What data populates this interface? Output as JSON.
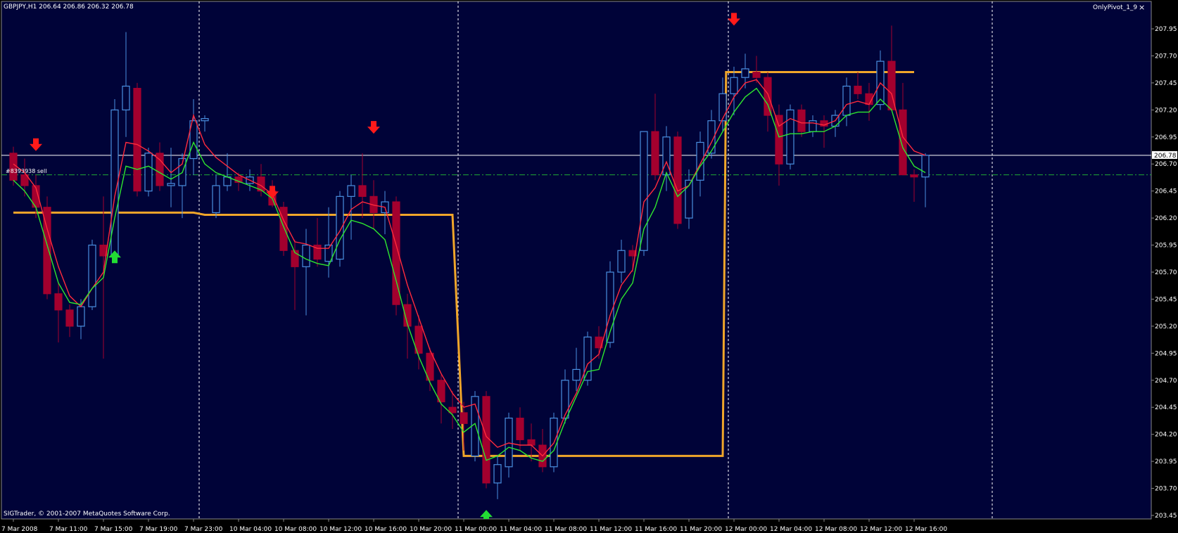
{
  "window": {
    "symbol_header": "GBPJPY,H1  206.64 206.86 206.32 206.78",
    "indicator_name": "OnlyPivot_1_9",
    "close_glyph": "×",
    "copyright": "SIGTrader, © 2001-2007 MetaQuotes Software Corp.",
    "order_label": "#8393938 sell",
    "current_price_label": "206.78"
  },
  "colors": {
    "background": "#000338",
    "bull_candle": "#4a8fe0",
    "bear_candle": "#a3002e",
    "fast_ma": "#ff2a3c",
    "slow_ma": "#2ee62e",
    "pivot": "#f0a62a",
    "order_line": "#1faa33",
    "current_price_line": "#ffffff",
    "separator": "#ffffff",
    "up_arrow": "#22dd33",
    "down_arrow": "#ff1a1a",
    "axis_text": "#ffffff"
  },
  "chart_data": {
    "type": "candlestick",
    "symbol": "GBPJPY",
    "timeframe": "H1",
    "ylim": [
      203.4,
      208.2
    ],
    "y_ticks": [
      207.95,
      207.7,
      207.45,
      207.2,
      206.95,
      206.7,
      206.45,
      206.2,
      205.95,
      205.7,
      205.45,
      205.2,
      204.95,
      204.7,
      204.45,
      204.2,
      203.95,
      203.7,
      203.45
    ],
    "y_tick_labels": [
      "207.95",
      "207.70",
      "207.45",
      "207.20",
      "206.95",
      "206.70",
      "206.45",
      "206.20",
      "205.95",
      "205.70",
      "205.45",
      "205.20",
      "204.95",
      "204.70",
      "204.45",
      "204.20",
      "203.95",
      "203.70",
      "203.45"
    ],
    "x_labels": [
      "7 Mar 2008",
      "7 Mar 11:00",
      "7 Mar 15:00",
      "7 Mar 19:00",
      "7 Mar 23:00",
      "10 Mar 04:00",
      "10 Mar 08:00",
      "10 Mar 12:00",
      "10 Mar 16:00",
      "10 Mar 20:00",
      "11 Mar 00:00",
      "11 Mar 04:00",
      "11 Mar 08:00",
      "11 Mar 12:00",
      "11 Mar 16:00",
      "11 Mar 20:00",
      "12 Mar 00:00",
      "12 Mar 04:00",
      "12 Mar 08:00",
      "12 Mar 12:00",
      "12 Mar 16:00"
    ],
    "x_label_bars": [
      0,
      4,
      8,
      12,
      16,
      20,
      24,
      28,
      32,
      36,
      40,
      44,
      48,
      52,
      56,
      60,
      64,
      68,
      72,
      76,
      80
    ],
    "session_separators_at_bar": [
      17,
      40,
      64
    ],
    "current_price": 206.78,
    "order_line_price": 206.6,
    "candles": [
      {
        "o": 206.8,
        "h": 206.86,
        "l": 206.5,
        "c": 206.55
      },
      {
        "o": 206.6,
        "h": 206.75,
        "l": 206.4,
        "c": 206.5
      },
      {
        "o": 206.5,
        "h": 206.6,
        "l": 206.2,
        "c": 206.3
      },
      {
        "o": 206.3,
        "h": 206.4,
        "l": 205.45,
        "c": 205.5
      },
      {
        "o": 205.5,
        "h": 205.6,
        "l": 205.05,
        "c": 205.35
      },
      {
        "o": 205.35,
        "h": 205.4,
        "l": 205.1,
        "c": 205.2
      },
      {
        "o": 205.2,
        "h": 205.45,
        "l": 205.08,
        "c": 205.38
      },
      {
        "o": 205.38,
        "h": 206.0,
        "l": 205.35,
        "c": 205.95
      },
      {
        "o": 205.95,
        "h": 206.4,
        "l": 204.9,
        "c": 205.85
      },
      {
        "o": 205.85,
        "h": 207.3,
        "l": 205.8,
        "c": 207.2
      },
      {
        "o": 207.2,
        "h": 207.92,
        "l": 206.95,
        "c": 207.42
      },
      {
        "o": 207.4,
        "h": 207.45,
        "l": 206.4,
        "c": 206.45
      },
      {
        "o": 206.45,
        "h": 206.85,
        "l": 206.4,
        "c": 206.8
      },
      {
        "o": 206.8,
        "h": 206.9,
        "l": 206.45,
        "c": 206.5
      },
      {
        "o": 206.5,
        "h": 206.85,
        "l": 206.3,
        "c": 206.52
      },
      {
        "o": 206.5,
        "h": 206.8,
        "l": 206.2,
        "c": 206.75
      },
      {
        "o": 206.75,
        "h": 207.3,
        "l": 206.6,
        "c": 207.1
      },
      {
        "o": 207.1,
        "h": 207.15,
        "l": 207.0,
        "c": 207.12
      },
      {
        "o": 206.25,
        "h": 206.6,
        "l": 206.2,
        "c": 206.5
      },
      {
        "o": 206.5,
        "h": 206.8,
        "l": 206.45,
        "c": 206.58
      },
      {
        "o": 206.58,
        "h": 206.62,
        "l": 206.45,
        "c": 206.53
      },
      {
        "o": 206.52,
        "h": 206.65,
        "l": 206.45,
        "c": 206.58
      },
      {
        "o": 206.58,
        "h": 206.7,
        "l": 206.4,
        "c": 206.45
      },
      {
        "o": 206.45,
        "h": 206.55,
        "l": 206.3,
        "c": 206.32
      },
      {
        "o": 206.3,
        "h": 206.35,
        "l": 205.85,
        "c": 205.9
      },
      {
        "o": 205.9,
        "h": 206.0,
        "l": 205.35,
        "c": 205.75
      },
      {
        "o": 205.75,
        "h": 206.1,
        "l": 205.3,
        "c": 205.95
      },
      {
        "o": 205.95,
        "h": 206.2,
        "l": 205.75,
        "c": 205.82
      },
      {
        "o": 205.8,
        "h": 206.3,
        "l": 205.65,
        "c": 205.95
      },
      {
        "o": 205.82,
        "h": 206.45,
        "l": 205.75,
        "c": 206.4
      },
      {
        "o": 206.4,
        "h": 206.6,
        "l": 206.0,
        "c": 206.5
      },
      {
        "o": 206.5,
        "h": 206.8,
        "l": 206.2,
        "c": 206.4
      },
      {
        "o": 206.4,
        "h": 206.55,
        "l": 206.1,
        "c": 206.25
      },
      {
        "o": 206.25,
        "h": 206.45,
        "l": 206.05,
        "c": 206.35
      },
      {
        "o": 206.35,
        "h": 206.4,
        "l": 205.3,
        "c": 205.4
      },
      {
        "o": 205.4,
        "h": 205.5,
        "l": 204.9,
        "c": 205.2
      },
      {
        "o": 205.2,
        "h": 205.3,
        "l": 204.8,
        "c": 204.95
      },
      {
        "o": 204.95,
        "h": 205.0,
        "l": 204.6,
        "c": 204.7
      },
      {
        "o": 204.7,
        "h": 204.75,
        "l": 204.3,
        "c": 204.5
      },
      {
        "o": 204.45,
        "h": 204.6,
        "l": 204.25,
        "c": 204.4
      },
      {
        "o": 204.4,
        "h": 204.5,
        "l": 204.05,
        "c": 204.3
      },
      {
        "o": 204.0,
        "h": 204.6,
        "l": 203.95,
        "c": 204.55
      },
      {
        "o": 204.55,
        "h": 204.6,
        "l": 203.7,
        "c": 203.75
      },
      {
        "o": 203.75,
        "h": 204.0,
        "l": 203.6,
        "c": 203.92
      },
      {
        "o": 203.9,
        "h": 204.4,
        "l": 203.8,
        "c": 204.35
      },
      {
        "o": 204.35,
        "h": 204.45,
        "l": 204.05,
        "c": 204.15
      },
      {
        "o": 204.15,
        "h": 204.3,
        "l": 203.95,
        "c": 204.1
      },
      {
        "o": 204.1,
        "h": 204.25,
        "l": 203.85,
        "c": 203.9
      },
      {
        "o": 203.9,
        "h": 204.4,
        "l": 203.85,
        "c": 204.35
      },
      {
        "o": 204.35,
        "h": 204.8,
        "l": 204.3,
        "c": 204.7
      },
      {
        "o": 204.7,
        "h": 205.0,
        "l": 204.6,
        "c": 204.8
      },
      {
        "o": 204.7,
        "h": 205.15,
        "l": 204.65,
        "c": 205.1
      },
      {
        "o": 205.1,
        "h": 205.2,
        "l": 204.9,
        "c": 205.0
      },
      {
        "o": 205.05,
        "h": 205.8,
        "l": 205.0,
        "c": 205.7
      },
      {
        "o": 205.7,
        "h": 206.0,
        "l": 205.6,
        "c": 205.9
      },
      {
        "o": 205.9,
        "h": 205.95,
        "l": 205.7,
        "c": 205.85
      },
      {
        "o": 205.9,
        "h": 207.0,
        "l": 205.85,
        "c": 207.0
      },
      {
        "o": 207.0,
        "h": 207.35,
        "l": 206.55,
        "c": 206.6
      },
      {
        "o": 206.6,
        "h": 207.05,
        "l": 206.45,
        "c": 206.95
      },
      {
        "o": 206.95,
        "h": 207.0,
        "l": 206.1,
        "c": 206.15
      },
      {
        "o": 206.2,
        "h": 206.65,
        "l": 206.1,
        "c": 206.55
      },
      {
        "o": 206.55,
        "h": 207.0,
        "l": 206.4,
        "c": 206.9
      },
      {
        "o": 206.8,
        "h": 207.2,
        "l": 206.75,
        "c": 207.1
      },
      {
        "o": 207.1,
        "h": 207.5,
        "l": 207.0,
        "c": 207.35
      },
      {
        "o": 207.35,
        "h": 207.6,
        "l": 207.15,
        "c": 207.5
      },
      {
        "o": 207.5,
        "h": 207.72,
        "l": 207.4,
        "c": 207.58
      },
      {
        "o": 207.55,
        "h": 207.7,
        "l": 207.45,
        "c": 207.5
      },
      {
        "o": 207.5,
        "h": 207.55,
        "l": 207.0,
        "c": 207.15
      },
      {
        "o": 207.15,
        "h": 207.25,
        "l": 206.5,
        "c": 206.7
      },
      {
        "o": 206.7,
        "h": 207.25,
        "l": 206.65,
        "c": 207.2
      },
      {
        "o": 207.2,
        "h": 207.25,
        "l": 206.95,
        "c": 207.0
      },
      {
        "o": 207.0,
        "h": 207.15,
        "l": 206.95,
        "c": 207.1
      },
      {
        "o": 207.1,
        "h": 207.15,
        "l": 206.85,
        "c": 207.05
      },
      {
        "o": 207.05,
        "h": 207.2,
        "l": 206.95,
        "c": 207.15
      },
      {
        "o": 207.15,
        "h": 207.5,
        "l": 207.05,
        "c": 207.42
      },
      {
        "o": 207.42,
        "h": 207.55,
        "l": 207.3,
        "c": 207.35
      },
      {
        "o": 207.35,
        "h": 207.45,
        "l": 207.1,
        "c": 207.25
      },
      {
        "o": 207.25,
        "h": 207.75,
        "l": 207.2,
        "c": 207.65
      },
      {
        "o": 207.65,
        "h": 207.98,
        "l": 207.2,
        "c": 207.2
      },
      {
        "o": 207.2,
        "h": 207.45,
        "l": 206.6,
        "c": 206.6
      },
      {
        "o": 206.6,
        "h": 206.65,
        "l": 206.35,
        "c": 206.58
      },
      {
        "o": 206.58,
        "h": 206.8,
        "l": 206.3,
        "c": 206.78
      }
    ],
    "series": [
      {
        "kind": "fast_ma",
        "values": [
          206.7,
          206.62,
          206.48,
          206.1,
          205.75,
          205.48,
          205.38,
          205.55,
          205.7,
          206.4,
          206.9,
          206.88,
          206.82,
          206.74,
          206.62,
          206.7,
          207.15,
          206.88,
          206.76,
          206.68,
          206.6,
          206.55,
          206.5,
          206.42,
          206.18,
          205.98,
          205.96,
          205.92,
          205.92,
          206.08,
          206.28,
          206.35,
          206.32,
          206.3,
          205.95,
          205.58,
          205.28,
          204.98,
          204.76,
          204.58,
          204.45,
          204.48,
          204.18,
          204.08,
          204.12,
          204.1,
          204.1,
          204.0,
          204.12,
          204.38,
          204.58,
          204.85,
          204.94,
          205.3,
          205.58,
          205.72,
          206.35,
          206.48,
          206.72,
          206.45,
          206.5,
          206.7,
          206.9,
          207.12,
          207.32,
          207.45,
          207.48,
          207.35,
          207.05,
          207.12,
          207.08,
          207.08,
          207.06,
          207.1,
          207.25,
          207.28,
          207.25,
          207.45,
          207.35,
          206.95,
          206.82,
          206.78
        ]
      },
      {
        "kind": "slow_ma",
        "values": [
          206.55,
          206.45,
          206.3,
          205.95,
          205.6,
          205.42,
          205.4,
          205.55,
          205.65,
          206.2,
          206.68,
          206.65,
          206.68,
          206.62,
          206.56,
          206.62,
          206.9,
          206.7,
          206.62,
          206.58,
          206.54,
          206.5,
          206.46,
          206.38,
          206.12,
          205.88,
          205.82,
          205.78,
          205.76,
          206.0,
          206.18,
          206.15,
          206.1,
          206.0,
          205.62,
          205.22,
          204.92,
          204.68,
          204.48,
          204.38,
          204.22,
          204.3,
          203.96,
          204.0,
          204.08,
          204.05,
          203.98,
          203.95,
          204.05,
          204.32,
          204.55,
          204.78,
          204.8,
          205.15,
          205.45,
          205.6,
          206.1,
          206.3,
          206.62,
          206.4,
          206.5,
          206.68,
          206.82,
          207.0,
          207.18,
          207.32,
          207.4,
          207.25,
          206.95,
          206.98,
          206.98,
          207.0,
          207.0,
          207.05,
          207.15,
          207.18,
          207.18,
          207.3,
          207.2,
          206.85,
          206.68,
          206.62
        ]
      },
      {
        "kind": "pivot",
        "points": [
          [
            0,
            206.25
          ],
          [
            16,
            206.25
          ],
          [
            17,
            206.23
          ],
          [
            39,
            206.23
          ],
          [
            40,
            204.0
          ],
          [
            63,
            204.0
          ],
          [
            63.3,
            207.55
          ],
          [
            80,
            207.55
          ]
        ]
      }
    ],
    "arrows": [
      {
        "bar": 2,
        "dir": "down",
        "price": 206.82
      },
      {
        "bar": 9,
        "dir": "up",
        "price": 205.9
      },
      {
        "bar": 23,
        "dir": "down",
        "price": 206.38
      },
      {
        "bar": 32,
        "dir": "down",
        "price": 206.98
      },
      {
        "bar": 40,
        "dir": "up",
        "price": 203.42
      },
      {
        "bar": 42,
        "dir": "up",
        "price": 203.5
      },
      {
        "bar": 45,
        "dir": "up",
        "price": 203.42
      },
      {
        "bar": 64,
        "dir": "down",
        "price": 207.98
      }
    ]
  }
}
